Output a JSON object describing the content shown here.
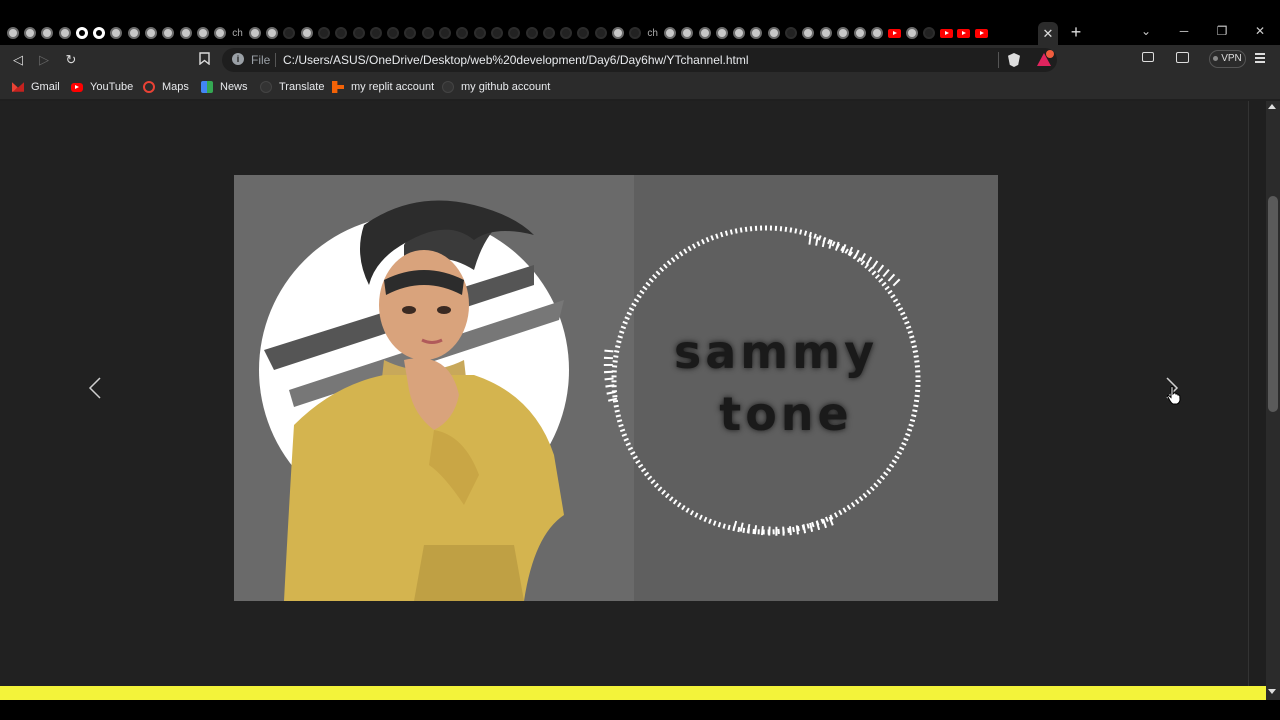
{
  "browser": {
    "tab_strip": {
      "favicons": [
        "globe",
        "globe",
        "globe",
        "globe",
        "github",
        "github",
        "globe",
        "globe",
        "globe",
        "globe",
        "globe",
        "history",
        "globe",
        "text:ch",
        "globe",
        "globe",
        "dim",
        "globe",
        "dim",
        "dim",
        "dim",
        "dim",
        "dim",
        "dim",
        "dim",
        "dim",
        "dim",
        "dim",
        "dim",
        "dim",
        "dim",
        "dim",
        "dim",
        "dim",
        "dim",
        "globe",
        "dim",
        "text:ch",
        "globe",
        "globe",
        "globe",
        "globe",
        "globe",
        "globe",
        "globe",
        "dim",
        "globe",
        "globe",
        "globe",
        "globe",
        "globe",
        "youtube",
        "globe",
        "dim",
        "youtube",
        "youtube",
        "youtube"
      ],
      "active_tab_close": "✕",
      "new_tab": "+",
      "controls": {
        "dropdown": "⌄",
        "minimize": "─",
        "restore": "❐",
        "close": "✕"
      }
    },
    "toolbar": {
      "back": "◁",
      "forward": "▷",
      "reload": "↻",
      "bookmark": "🔖",
      "url_scheme": "File",
      "url": "C:/Users/ASUS/OneDrive/Desktop/web%20development/Day6/Day6hw/YTchannel.html",
      "vpn_label": "VPN"
    },
    "bookmarks": [
      {
        "label": "Gmail",
        "icon": "gmail-icon"
      },
      {
        "label": "YouTube",
        "icon": "youtube-icon"
      },
      {
        "label": "Maps",
        "icon": "maps-icon"
      },
      {
        "label": "News",
        "icon": "news-icon"
      },
      {
        "label": "Translate",
        "icon": "translate-icon"
      },
      {
        "label": "my replit account",
        "icon": "replit-icon"
      },
      {
        "label": "my github account",
        "icon": "github-icon"
      }
    ]
  },
  "page": {
    "carousel": {
      "prev_icon": "chevron-left-icon",
      "next_icon": "chevron-right-icon",
      "slide": {
        "banner_line1": "sammy",
        "banner_line2": "tone"
      }
    },
    "footer_color": "#f3f33a"
  }
}
